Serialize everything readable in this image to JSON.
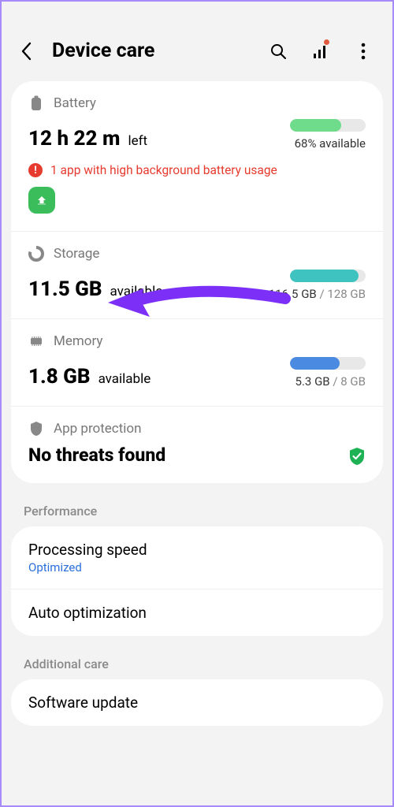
{
  "header": {
    "title": "Device care"
  },
  "battery": {
    "label": "Battery",
    "value": "12 h 22 m",
    "value_suffix": "left",
    "percent_text": "68% available",
    "fill_pct": 68,
    "fill_color": "#6fdc8c",
    "warning_text": "1 app with high background battery usage"
  },
  "storage": {
    "label": "Storage",
    "value": "11.5 GB",
    "value_suffix": "available",
    "used_text": "116.5 GB",
    "total_text": " / 128 GB",
    "fill_pct": 91,
    "fill_color": "#3fc3c0"
  },
  "memory": {
    "label": "Memory",
    "value": "1.8 GB",
    "value_suffix": "available",
    "used_text": "5.3 GB",
    "total_text": " / 8 GB",
    "fill_pct": 66,
    "fill_color": "#4a8ae0"
  },
  "protection": {
    "label": "App protection",
    "status": "No threats found"
  },
  "groups": {
    "performance_label": "Performance",
    "additional_label": "Additional care"
  },
  "perf": {
    "processing_title": "Processing speed",
    "processing_status": "Optimized",
    "auto_opt_title": "Auto optimization",
    "software_update_title": "Software update"
  }
}
